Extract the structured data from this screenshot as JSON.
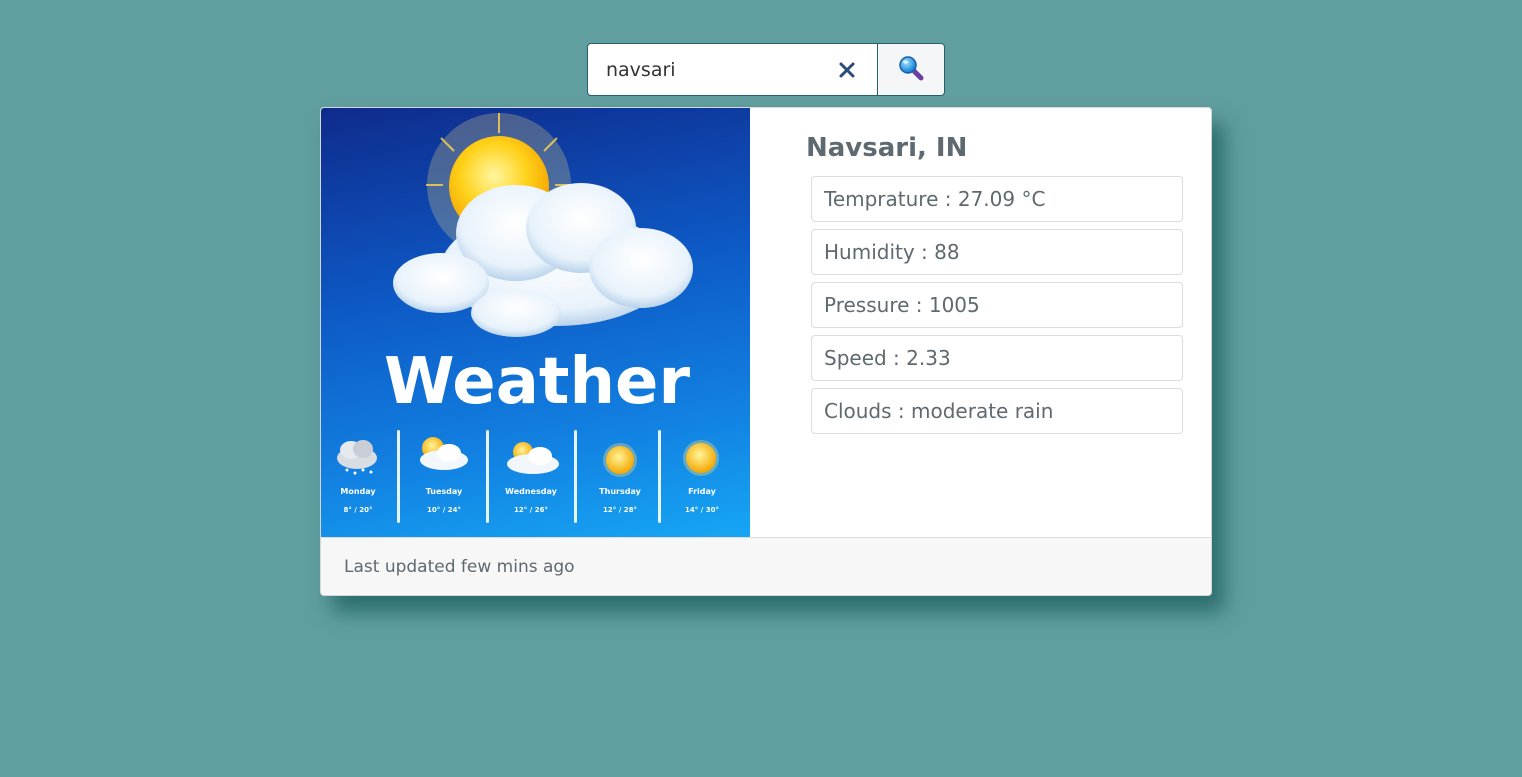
{
  "search": {
    "value": "navsari",
    "clear_icon": "close-icon",
    "search_icon": "magnifier-icon"
  },
  "card": {
    "image": {
      "title": "Weather",
      "days": [
        {
          "name": "Monday",
          "temp": "8° / 20°",
          "icon": "snow-cloud-icon"
        },
        {
          "name": "Tuesday",
          "temp": "10° / 24°",
          "icon": "partly-cloudy-icon"
        },
        {
          "name": "Wednesday",
          "temp": "12° / 26°",
          "icon": "partly-cloudy-icon"
        },
        {
          "name": "Thursday",
          "temp": "12° / 28°",
          "icon": "sun-icon"
        },
        {
          "name": "Friday",
          "temp": "14° / 30°",
          "icon": "sun-icon"
        }
      ]
    },
    "city": "Navsari, IN",
    "stats": [
      "Temprature : 27.09 °C",
      "Humidity : 88",
      "Pressure : 1005",
      "Speed : 2.33",
      "Clouds : moderate rain"
    ],
    "footer": "Last updated few mins ago"
  },
  "colors": {
    "background": "#609e9f",
    "border_accent": "#2a5f66",
    "text": "#5f6970",
    "clear_icon": "#2c4a7a"
  }
}
